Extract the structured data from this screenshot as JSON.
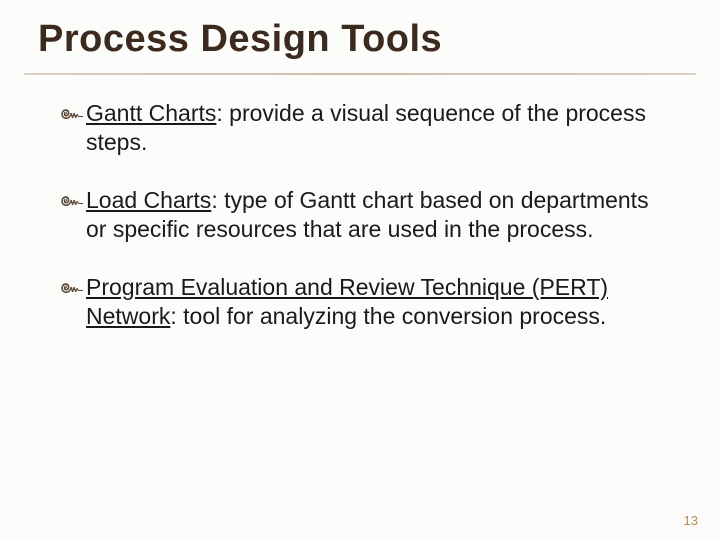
{
  "title": "Process Design Tools",
  "bullet_glyph": "๛",
  "items": [
    {
      "term": "Gantt Charts",
      "desc": ": provide a visual sequence of the process steps."
    },
    {
      "term": "Load Charts",
      "desc": ": type of Gantt chart based on departments or specific resources that are used in the process."
    },
    {
      "term": "Program Evaluation and Review Technique (PERT) Network",
      "desc": ": tool for analyzing the conversion process."
    }
  ],
  "page_number": "13"
}
